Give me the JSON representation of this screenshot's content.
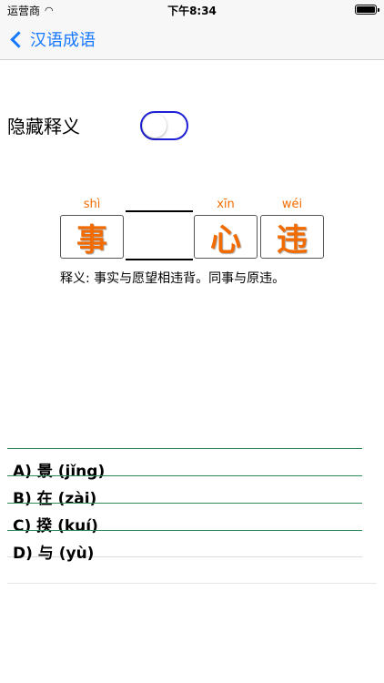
{
  "status": {
    "carrier": "运营商",
    "time": "下午8:34"
  },
  "nav": {
    "back_label": "汉语成语"
  },
  "settings": {
    "toggle_label": "隐藏释义",
    "toggle_on": false
  },
  "idiom": {
    "cells": [
      {
        "pinyin": "shì",
        "char": "事"
      },
      {
        "pinyin": "",
        "char": ""
      },
      {
        "pinyin": "xīn",
        "char": "心"
      },
      {
        "pinyin": "wéi",
        "char": "违"
      }
    ],
    "definition": "释义: 事实与愿望相违背。同事与原违。"
  },
  "options": [
    "A) 景 (jǐng)",
    "B) 在 (zài)",
    "C) 揆 (kuí)",
    "D) 与 (yù)"
  ],
  "colors": {
    "accent": "#1677ff",
    "char": "#f26b00",
    "divider": "#2e8b57",
    "toggle_border": "#1f1fd6"
  }
}
